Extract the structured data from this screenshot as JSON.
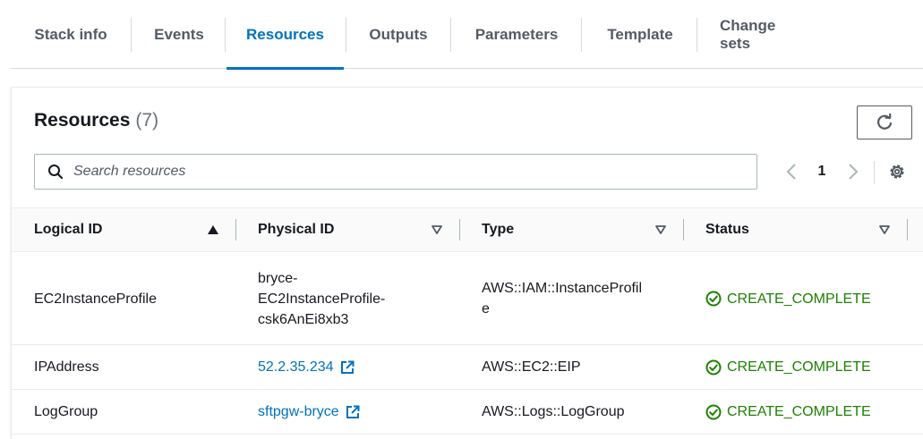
{
  "tabs": [
    {
      "label": "Stack info",
      "active": false
    },
    {
      "label": "Events",
      "active": false
    },
    {
      "label": "Resources",
      "active": true
    },
    {
      "label": "Outputs",
      "active": false
    },
    {
      "label": "Parameters",
      "active": false
    },
    {
      "label": "Template",
      "active": false
    },
    {
      "label": "Change sets",
      "active": false
    }
  ],
  "panel": {
    "title": "Resources",
    "count": "(7)"
  },
  "search": {
    "placeholder": "Search resources",
    "value": ""
  },
  "pagination": {
    "current_page": "1"
  },
  "columns": [
    {
      "label": "Logical ID",
      "sort": "ascending"
    },
    {
      "label": "Physical ID",
      "sort": "none"
    },
    {
      "label": "Type",
      "sort": "none"
    },
    {
      "label": "Status",
      "sort": "none"
    }
  ],
  "rows": [
    {
      "logical_id": "EC2InstanceProfile",
      "physical_id_lines": [
        "bryce-",
        "EC2InstanceProfile-",
        "csk6AnEi8xb3"
      ],
      "physical_is_link": false,
      "type_lines": [
        "AWS::IAM::InstanceProfil",
        "e"
      ],
      "status": "CREATE_COMPLETE"
    },
    {
      "logical_id": "IPAddress",
      "physical_id": "52.2.35.234",
      "physical_is_link": true,
      "type": "AWS::EC2::EIP",
      "status": "CREATE_COMPLETE"
    },
    {
      "logical_id": "LogGroup",
      "physical_id": "sftpgw-bryce",
      "physical_is_link": true,
      "type": "AWS::Logs::LogGroup",
      "status": "CREATE_COMPLETE"
    }
  ],
  "colors": {
    "accent": "#0073bb",
    "success": "#1d8102",
    "text": "#16191f",
    "muted": "#545b64",
    "border": "#eaeded"
  },
  "icons": {
    "refresh": "refresh-icon",
    "search": "search-icon",
    "prev": "chevron-left-icon",
    "next": "chevron-right-icon",
    "settings": "gear-icon",
    "external": "external-link-icon",
    "status": "check-circle-icon"
  }
}
